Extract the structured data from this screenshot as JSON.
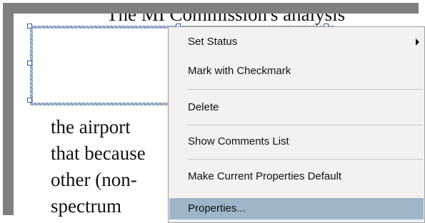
{
  "document": {
    "top_fragment": "The MI Commission's analysis",
    "lines": [
      "the airport",
      "that because",
      "other (non-",
      "spectrum"
    ]
  },
  "context_menu": {
    "items": [
      {
        "label": "Set Status",
        "has_submenu": true
      },
      {
        "label": "Mark with Checkmark"
      },
      {
        "label": "Delete"
      },
      {
        "label": "Show Comments List"
      },
      {
        "label": "Make Current Properties Default"
      },
      {
        "label": "Properties...",
        "selected": true
      }
    ],
    "colors": {
      "background": "#f2f2f2",
      "selected_background": "#9fb6c9",
      "separator": "#c9c9c9"
    }
  },
  "annotation": {
    "border_color": "#7f97b4",
    "handle_color": "#3b57a6"
  },
  "backdrop_color": "#808080"
}
